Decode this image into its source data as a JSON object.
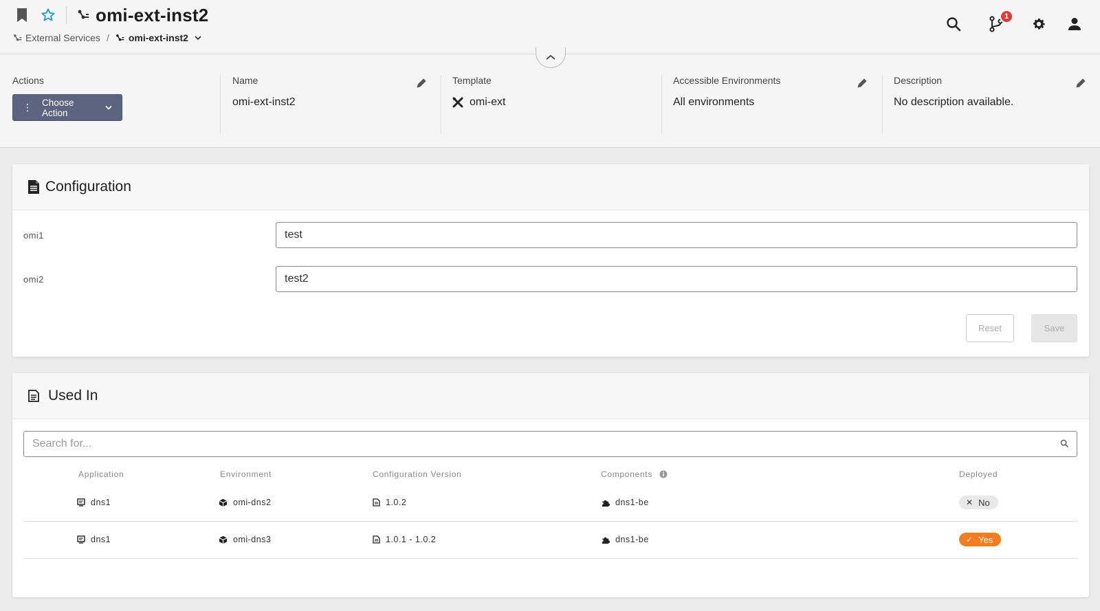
{
  "header": {
    "title": "omi-ext-inst2",
    "breadcrumb": {
      "parent": "External Services",
      "separator": "/",
      "current": "omi-ext-inst2"
    },
    "notification_count": "1",
    "icons": [
      "bookmark-icon",
      "star-icon",
      "external-service-icon",
      "search-icon",
      "git-branch-icon",
      "gear-icon",
      "user-icon",
      "chevron-down-icon",
      "chevron-up-icon"
    ]
  },
  "info": {
    "actions": {
      "label": "Actions",
      "button": "Choose Action"
    },
    "name": {
      "label": "Name",
      "value": "omi-ext-inst2"
    },
    "template": {
      "label": "Template",
      "value": "omi-ext"
    },
    "environments": {
      "label": "Accessible Environments",
      "value": "All environments"
    },
    "description": {
      "label": "Description",
      "value": "No description available."
    }
  },
  "configuration": {
    "title": "Configuration",
    "fields": [
      {
        "key": "omi1",
        "value": "test"
      },
      {
        "key": "omi2",
        "value": "test2"
      }
    ],
    "reset_label": "Reset",
    "save_label": "Save"
  },
  "used_in": {
    "title": "Used In",
    "search_placeholder": "Search for...",
    "columns": [
      "Application",
      "Environment",
      "Configuration Version",
      "Components",
      "Deployed"
    ],
    "rows": [
      {
        "application": "dns1",
        "environment": "omi-dns2",
        "version": "1.0.2",
        "component": "dns1-be",
        "deployed": "No",
        "deployed_state": false
      },
      {
        "application": "dns1",
        "environment": "omi-dns3",
        "version": "1.0.1 - 1.0.2",
        "component": "dns1-be",
        "deployed": "Yes",
        "deployed_state": true
      }
    ]
  },
  "colors": {
    "accent": "#5d6480",
    "star": "#1e9ad6",
    "badge": "#e53935",
    "deployed_yes": "#f57c1f",
    "deployed_no": "#e8e8e8"
  }
}
